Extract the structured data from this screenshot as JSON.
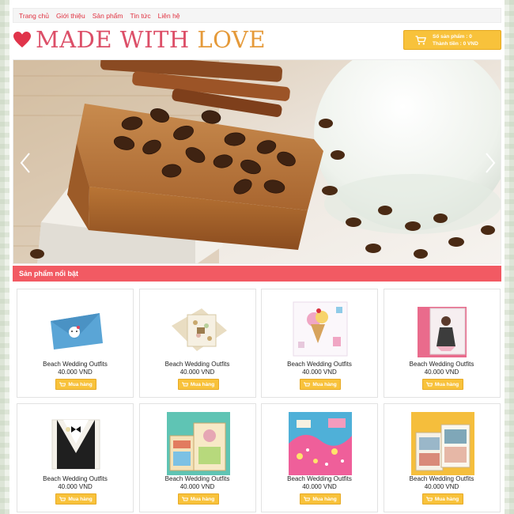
{
  "nav": {
    "items": [
      "Trang chủ",
      "Giới thiệu",
      "Sản phẩm",
      "Tin tức",
      "Liên hệ"
    ]
  },
  "header": {
    "logo_part1": "MADE WITH ",
    "logo_part2": "LOVE",
    "cart": {
      "count_line": "Số sản phẩm : 0",
      "total_line": "Thành tiền : 0 VND"
    }
  },
  "featured": {
    "title": "Sản phẩm nổi bật",
    "products": [
      {
        "name": "Beach Wedding Outfits",
        "price": "40.000 VND",
        "buy": "Mua hàng",
        "image": "hello-kitty-blue-card"
      },
      {
        "name": "Beach Wedding Outfits",
        "price": "40.000 VND",
        "buy": "Mua hàng",
        "image": "floral-kraft-card"
      },
      {
        "name": "Beach Wedding Outfits",
        "price": "40.000 VND",
        "buy": "Mua hàng",
        "image": "ice-cream-card"
      },
      {
        "name": "Beach Wedding Outfits",
        "price": "40.000 VND",
        "buy": "Mua hàng",
        "image": "pink-girl-card"
      },
      {
        "name": "Beach Wedding Outfits",
        "price": "40.000 VND",
        "buy": "Mua hàng",
        "image": "tuxedo-card"
      },
      {
        "name": "Beach Wedding Outfits",
        "price": "40.000 VND",
        "buy": "Mua hàng",
        "image": "scrapbook-teal-cards"
      },
      {
        "name": "Beach Wedding Outfits",
        "price": "40.000 VND",
        "buy": "Mua hàng",
        "image": "blue-pink-collage-card"
      },
      {
        "name": "Beach Wedding Outfits",
        "price": "40.000 VND",
        "buy": "Mua hàng",
        "image": "yellow-photo-cards"
      }
    ]
  },
  "colors": {
    "accent_red": "#f25a63",
    "button_yellow": "#f8c23b",
    "nav_link": "#e0303f"
  }
}
